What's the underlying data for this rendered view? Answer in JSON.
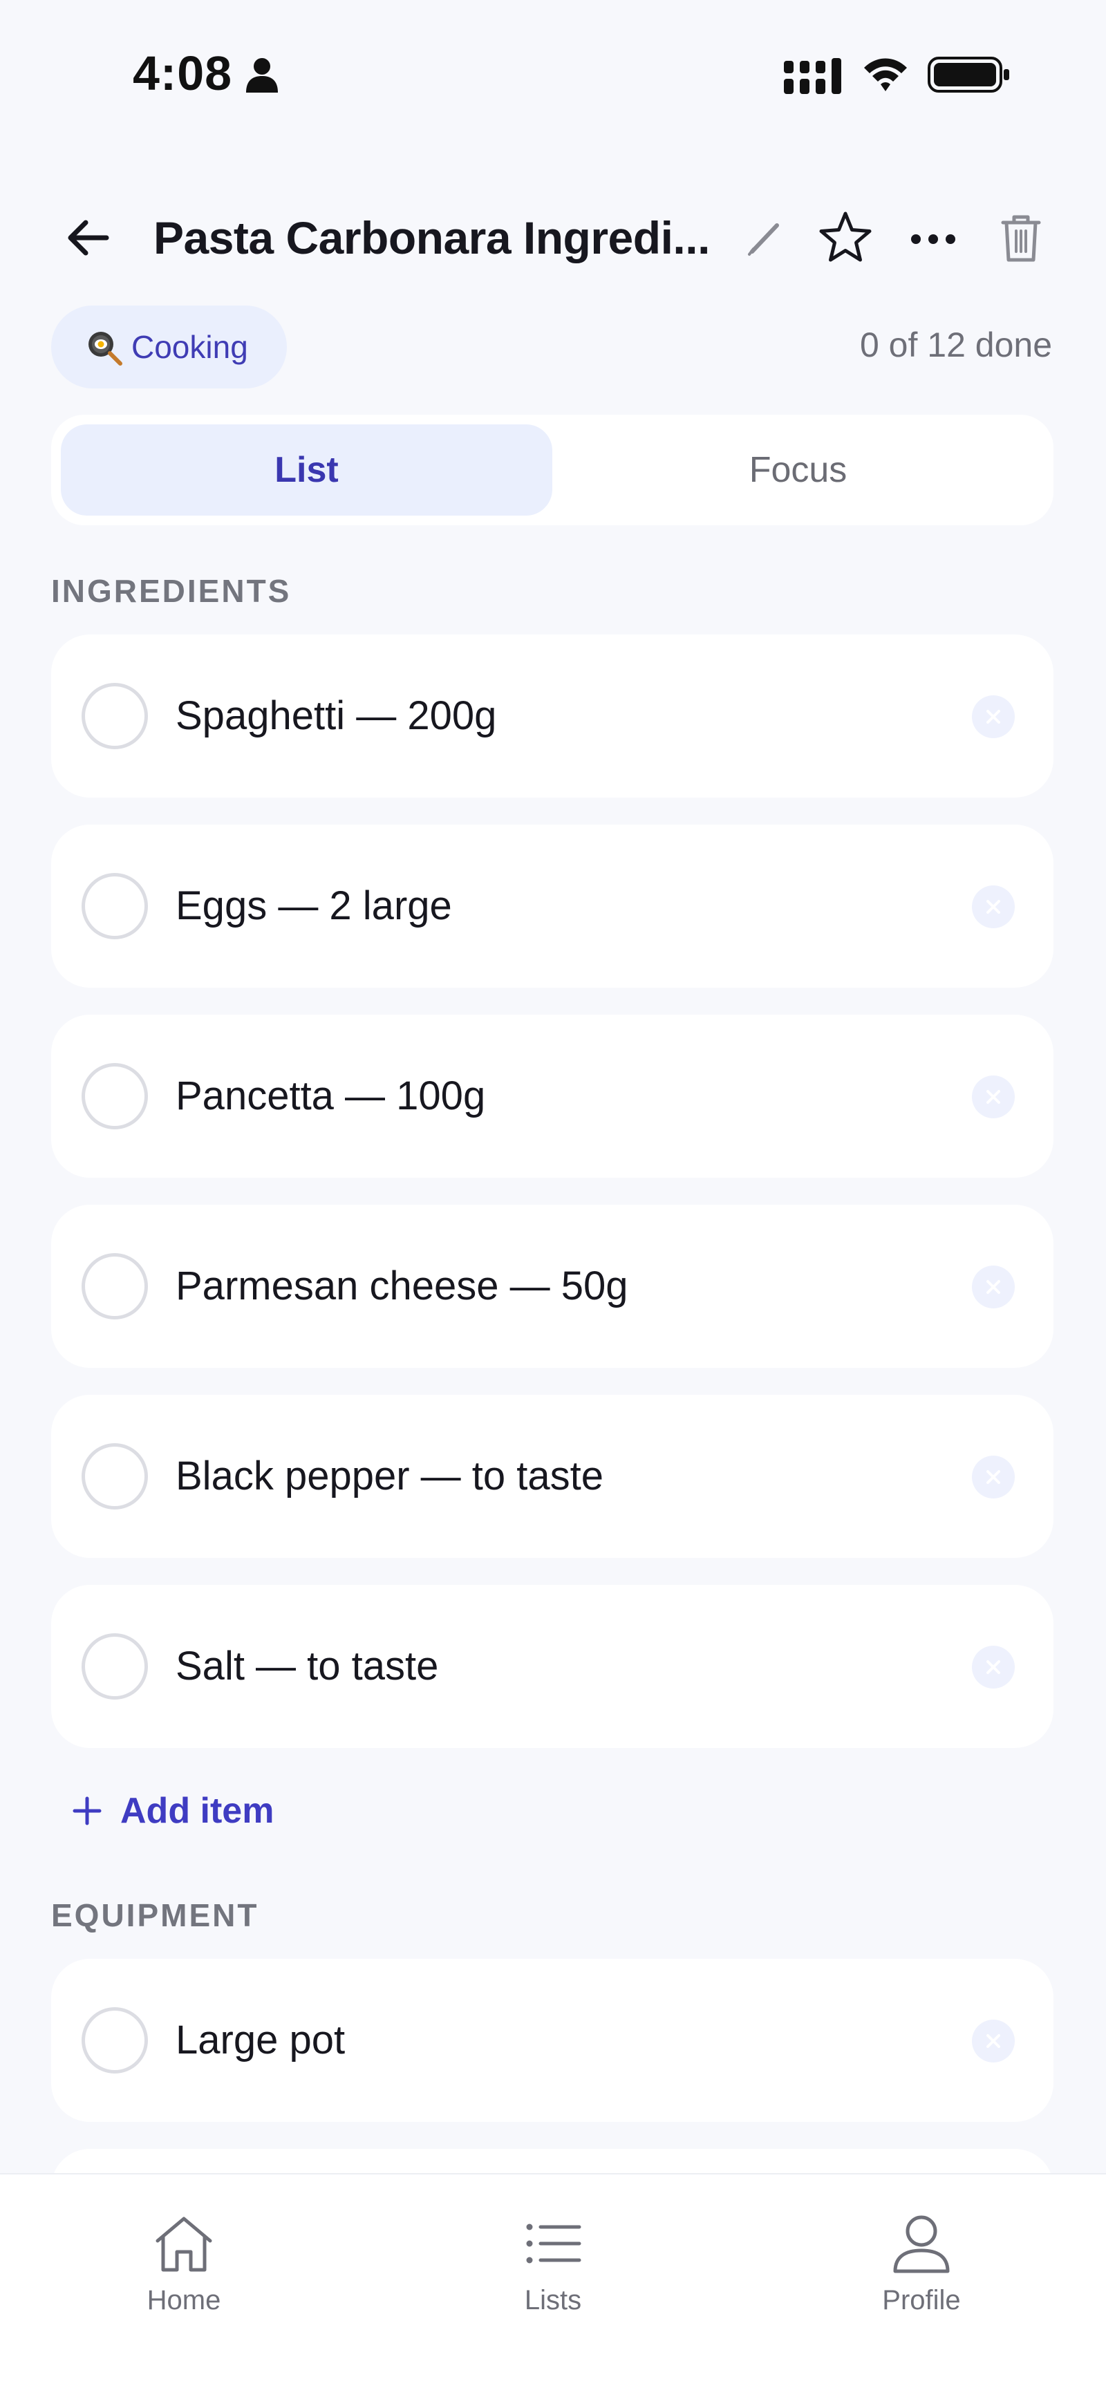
{
  "status_bar": {
    "time": "4:08"
  },
  "header": {
    "title": "Pasta Carbonara Ingredi...",
    "icons": [
      "back-arrow-icon",
      "pencil-icon",
      "star-icon",
      "more-icon",
      "trash-icon"
    ]
  },
  "category": {
    "emoji_icon": "frying-pan-icon",
    "label": "Cooking"
  },
  "progress": "0 of 12 done",
  "tabs": [
    {
      "label": "List",
      "active": true
    },
    {
      "label": "Focus",
      "active": false
    }
  ],
  "sections": [
    {
      "title": "INGREDIENTS",
      "items": [
        {
          "label": "Spaghetti — 200g",
          "checked": false
        },
        {
          "label": "Eggs — 2 large",
          "checked": false
        },
        {
          "label": "Pancetta — 100g",
          "checked": false
        },
        {
          "label": "Parmesan cheese — 50g",
          "checked": false
        },
        {
          "label": "Black pepper — to taste",
          "checked": false
        },
        {
          "label": "Salt — to taste",
          "checked": false
        }
      ],
      "add_label": "Add item"
    },
    {
      "title": "EQUIPMENT",
      "items": [
        {
          "label": "Large pot",
          "checked": false
        }
      ]
    }
  ],
  "bottom_nav": [
    {
      "label": "Home",
      "icon": "home-icon"
    },
    {
      "label": "Lists",
      "icon": "list-icon"
    },
    {
      "label": "Profile",
      "icon": "person-icon"
    }
  ],
  "colors": {
    "accent": "#3f3cc2",
    "chip_bg": "#eaeffd",
    "background": "#f7f8fc"
  }
}
